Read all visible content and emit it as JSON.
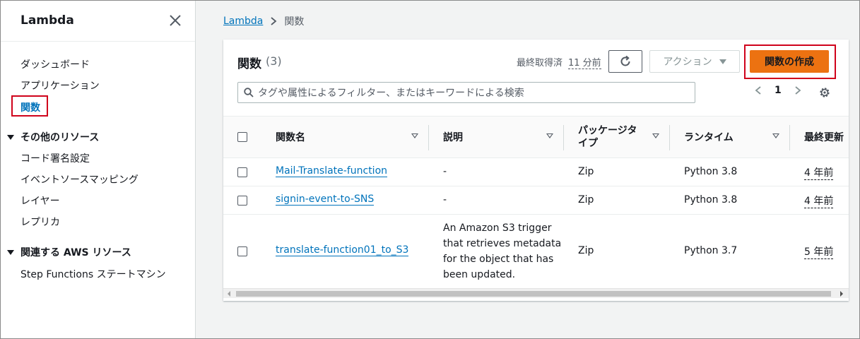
{
  "sidebar": {
    "title": "Lambda",
    "items": [
      {
        "label": "ダッシュボード"
      },
      {
        "label": "アプリケーション"
      },
      {
        "label": "関数"
      }
    ],
    "other_resources": {
      "label": "その他のリソース",
      "items": [
        "コード署名設定",
        "イベントソースマッピング",
        "レイヤー",
        "レプリカ"
      ]
    },
    "aws_resources": {
      "label": "関連する AWS リソース",
      "items": [
        "Step Functions ステートマシン"
      ]
    }
  },
  "breadcrumb": {
    "root": "Lambda",
    "current": "関数"
  },
  "panel": {
    "title": "関数",
    "count": "(3)",
    "last_fetch_label": "最終取得済",
    "last_fetch_value": "11 分前",
    "action_label": "アクション",
    "create_label": "関数の作成",
    "search_placeholder": "タグや属性によるフィルター、またはキーワードによる検索",
    "page": "1"
  },
  "table": {
    "columns": [
      "関数名",
      "説明",
      "パッケージタイプ",
      "ランタイム",
      "最終更新"
    ],
    "package_header_line1": "パッケージタ",
    "package_header_line2": "イプ",
    "rows": [
      {
        "name": "Mail-Translate-function",
        "description": "-",
        "package": "Zip",
        "runtime": "Python 3.8",
        "updated": "4 年前"
      },
      {
        "name": "signin-event-to-SNS",
        "description": "-",
        "package": "Zip",
        "runtime": "Python 3.8",
        "updated": "4 年前"
      },
      {
        "name": "translate-function01_to_S3",
        "description_lines": [
          "An Amazon S3 trigger",
          "that retrieves metadata",
          "for the object that has",
          "been updated."
        ],
        "package": "Zip",
        "runtime": "Python 3.7",
        "updated": "5 年前"
      }
    ]
  },
  "colors": {
    "accent_link": "#0073bb",
    "create_button": "#ec7211",
    "highlight_box": "#d0021b"
  }
}
